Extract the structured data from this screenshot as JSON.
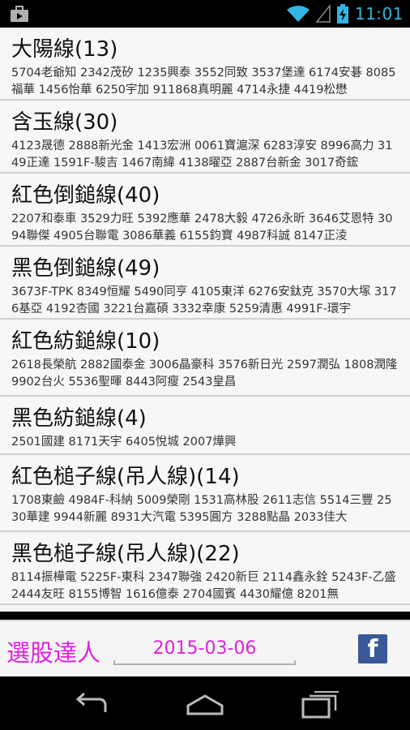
{
  "status_bar": {
    "time": "11:01",
    "left_icon": "briefcase-notification-icon",
    "icons": [
      "wifi-icon",
      "signal-icon",
      "battery-charging-icon"
    ]
  },
  "lists": [
    {
      "title": "大陽線(13)",
      "stocks": "5704老爺知 2342茂矽 1235興泰 3552同致 3537堡達 6174安碁 8085福華 1456怡華 6250宇加 911868真明麗 4714永捷 4419松懋"
    },
    {
      "title": "含玉線(30)",
      "stocks": "4123晟德 2888新光金 1413宏洲 0061寶滬深 6283淳安 8996高力 3149正達 1591F-駿吉 1467南緯 4138曜亞 2887台新金 3017奇鋐"
    },
    {
      "title": "紅色倒鎚線(40)",
      "stocks": "2207和泰車 3529力旺 5392應華 2478大毅 4726永昕 3646艾恩特 3094聯傑 4905台聯電 3086華義 6155鈞寶 4987科誠 8147正淩"
    },
    {
      "title": "黑色倒鎚線(49)",
      "stocks": "3673F-TPK 8349恒耀 5490同亨 4105東洋 6276安鈦克 3570大塚 3176基亞 4192杏國 3221台嘉碩 3332幸康 5259清惠 4991F-環宇"
    },
    {
      "title": "紅色紡鎚線(10)",
      "stocks": "2618長榮航 2882國泰金 3006晶豪科 3576新日光 2597潤弘 1808潤隆 9902台火 5536聖暉 8443阿瘦 2543皇昌"
    },
    {
      "title": "黑色紡鎚線(4)",
      "stocks": "2501國建 8171天宇 6405悅城 2007燁興"
    },
    {
      "title": "紅色槌子線(吊人線)(14)",
      "stocks": "1708東鹼 4984F-科納 5009榮剛 1531高林股 2611志信 5514三豐 2530華建 9944新麗 8931大汽電 5395圓方 3288點晶 2033佳大"
    },
    {
      "title": "黑色槌子線(吊人線)(22)",
      "stocks": "8114振樺電 5225F-東科 2347聯強 2420新巨 2114鑫永銓 5243F-乙盛 2444友旺 8155博智 1616億泰 2704國賓 4430耀億 8201無"
    }
  ],
  "bottom": {
    "brand": "選股達人",
    "date": "2015-03-06",
    "fb_letter": "f",
    "accent_color": "#e020e0",
    "fb_color": "#3b5998"
  },
  "nav": [
    "back-icon",
    "home-icon",
    "recent-apps-icon"
  ]
}
